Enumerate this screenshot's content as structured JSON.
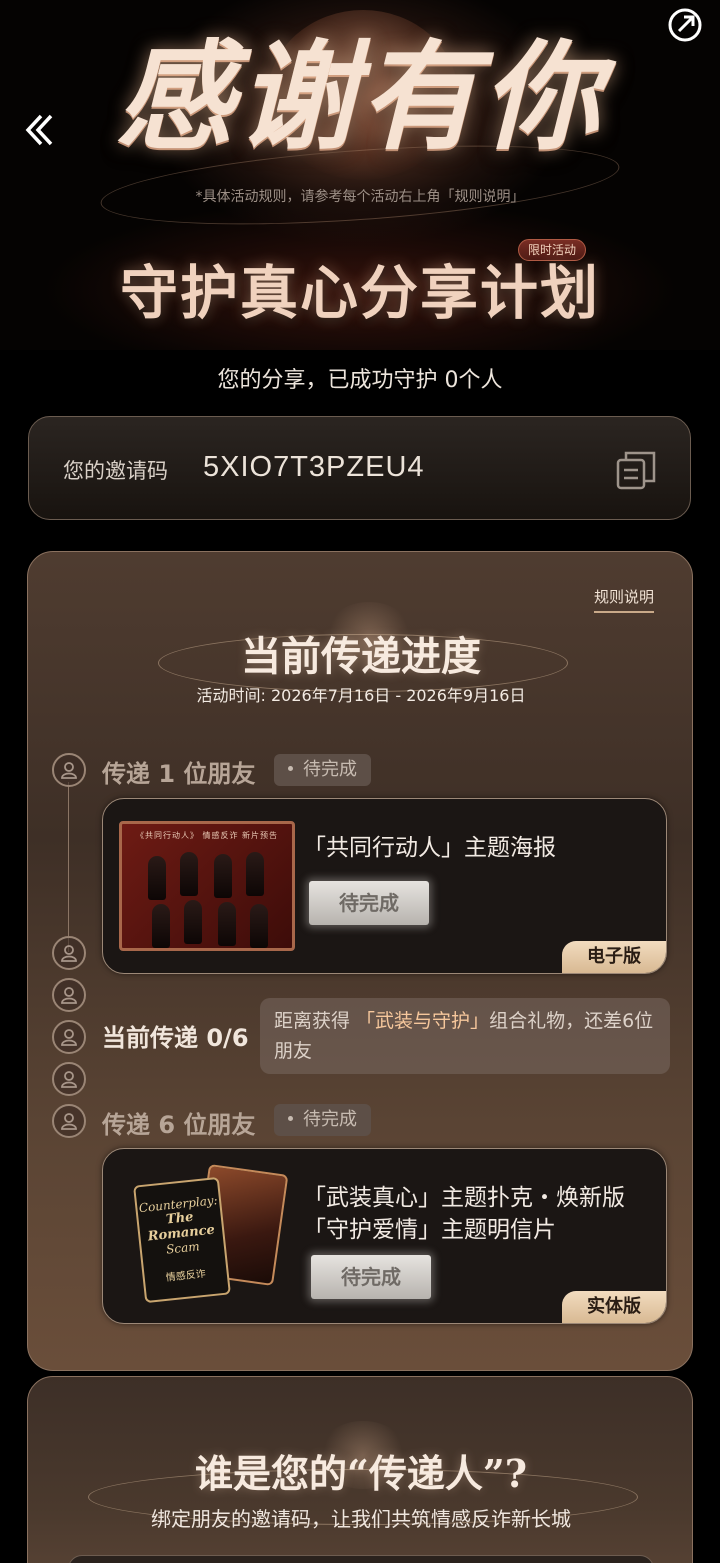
{
  "header": {
    "title": "感谢有你",
    "note": "*具体活动规则，请参考每个活动右上角「规则说明」",
    "badge": "限时活动",
    "subtitle": "守护真心分享计划",
    "back_icon": "double-chevron-left-icon",
    "share_icon": "share-arrow-icon"
  },
  "summary": {
    "protect_text": "您的分享，已成功守护 0个人"
  },
  "invite": {
    "label": "您的邀请码",
    "code": "5XIO7T3PZEU4",
    "copy_icon": "copy-icon"
  },
  "progress": {
    "rules_link": "规则说明",
    "title": "当前传递进度",
    "date_range": "活动时间: 2026年7月16日 - 2026年9月16日",
    "steps": [
      {
        "label": "传递 1 位朋友",
        "status": "待完成",
        "reward": {
          "title": "「共同行动人」主题海报",
          "button": "待完成",
          "tag": "电子版",
          "poster_head": "《共同行动人》 情感反诈 新片预告"
        }
      },
      {
        "label": "传递 6 位朋友",
        "status": "待完成",
        "reward": {
          "title_line1": "「武装真心」主题扑克・焕新版",
          "title_line2": "「守护爱情」主题明信片",
          "button": "待完成",
          "tag": "实体版",
          "card_line1": "Counterplay:",
          "card_line2": "The Romance",
          "card_line3": "Scam",
          "card_line4": "情感反诈"
        }
      }
    ],
    "current": {
      "label": "当前传递 0/6",
      "text_before": "距离获得 ",
      "highlight": "「武装与守护」",
      "text_after": "组合礼物，还差6位朋友"
    }
  },
  "binding": {
    "title": "谁是您的“传递人”?",
    "subtitle": "绑定朋友的邀请码，让我们共筑情感反诈新长城"
  },
  "colors": {
    "background": "#000000",
    "accent_gold": "#d8b993",
    "highlight": "#f6c79c",
    "panel_brown": "#4f3c30"
  }
}
